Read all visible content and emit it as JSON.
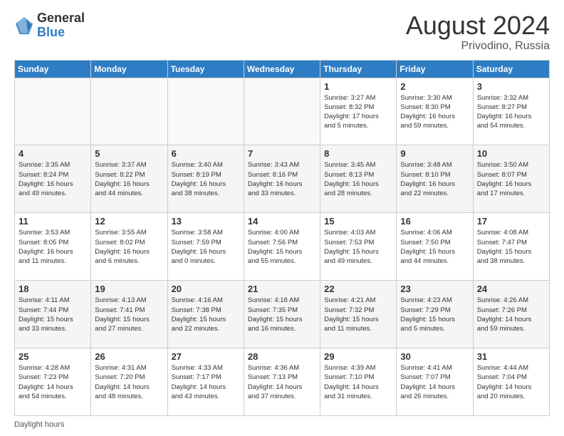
{
  "header": {
    "logo_general": "General",
    "logo_blue": "Blue",
    "month": "August 2024",
    "location": "Privodino, Russia"
  },
  "days_of_week": [
    "Sunday",
    "Monday",
    "Tuesday",
    "Wednesday",
    "Thursday",
    "Friday",
    "Saturday"
  ],
  "footer_label": "Daylight hours",
  "weeks": [
    [
      {
        "num": "",
        "info": ""
      },
      {
        "num": "",
        "info": ""
      },
      {
        "num": "",
        "info": ""
      },
      {
        "num": "",
        "info": ""
      },
      {
        "num": "1",
        "info": "Sunrise: 3:27 AM\nSunset: 8:32 PM\nDaylight: 17 hours\nand 5 minutes."
      },
      {
        "num": "2",
        "info": "Sunrise: 3:30 AM\nSunset: 8:30 PM\nDaylight: 16 hours\nand 59 minutes."
      },
      {
        "num": "3",
        "info": "Sunrise: 3:32 AM\nSunset: 8:27 PM\nDaylight: 16 hours\nand 54 minutes."
      }
    ],
    [
      {
        "num": "4",
        "info": "Sunrise: 3:35 AM\nSunset: 8:24 PM\nDaylight: 16 hours\nand 49 minutes."
      },
      {
        "num": "5",
        "info": "Sunrise: 3:37 AM\nSunset: 8:22 PM\nDaylight: 16 hours\nand 44 minutes."
      },
      {
        "num": "6",
        "info": "Sunrise: 3:40 AM\nSunset: 8:19 PM\nDaylight: 16 hours\nand 38 minutes."
      },
      {
        "num": "7",
        "info": "Sunrise: 3:43 AM\nSunset: 8:16 PM\nDaylight: 16 hours\nand 33 minutes."
      },
      {
        "num": "8",
        "info": "Sunrise: 3:45 AM\nSunset: 8:13 PM\nDaylight: 16 hours\nand 28 minutes."
      },
      {
        "num": "9",
        "info": "Sunrise: 3:48 AM\nSunset: 8:10 PM\nDaylight: 16 hours\nand 22 minutes."
      },
      {
        "num": "10",
        "info": "Sunrise: 3:50 AM\nSunset: 8:07 PM\nDaylight: 16 hours\nand 17 minutes."
      }
    ],
    [
      {
        "num": "11",
        "info": "Sunrise: 3:53 AM\nSunset: 8:05 PM\nDaylight: 16 hours\nand 11 minutes."
      },
      {
        "num": "12",
        "info": "Sunrise: 3:55 AM\nSunset: 8:02 PM\nDaylight: 16 hours\nand 6 minutes."
      },
      {
        "num": "13",
        "info": "Sunrise: 3:58 AM\nSunset: 7:59 PM\nDaylight: 16 hours\nand 0 minutes."
      },
      {
        "num": "14",
        "info": "Sunrise: 4:00 AM\nSunset: 7:56 PM\nDaylight: 15 hours\nand 55 minutes."
      },
      {
        "num": "15",
        "info": "Sunrise: 4:03 AM\nSunset: 7:53 PM\nDaylight: 15 hours\nand 49 minutes."
      },
      {
        "num": "16",
        "info": "Sunrise: 4:06 AM\nSunset: 7:50 PM\nDaylight: 15 hours\nand 44 minutes."
      },
      {
        "num": "17",
        "info": "Sunrise: 4:08 AM\nSunset: 7:47 PM\nDaylight: 15 hours\nand 38 minutes."
      }
    ],
    [
      {
        "num": "18",
        "info": "Sunrise: 4:11 AM\nSunset: 7:44 PM\nDaylight: 15 hours\nand 33 minutes."
      },
      {
        "num": "19",
        "info": "Sunrise: 4:13 AM\nSunset: 7:41 PM\nDaylight: 15 hours\nand 27 minutes."
      },
      {
        "num": "20",
        "info": "Sunrise: 4:16 AM\nSunset: 7:38 PM\nDaylight: 15 hours\nand 22 minutes."
      },
      {
        "num": "21",
        "info": "Sunrise: 4:18 AM\nSunset: 7:35 PM\nDaylight: 15 hours\nand 16 minutes."
      },
      {
        "num": "22",
        "info": "Sunrise: 4:21 AM\nSunset: 7:32 PM\nDaylight: 15 hours\nand 11 minutes."
      },
      {
        "num": "23",
        "info": "Sunrise: 4:23 AM\nSunset: 7:29 PM\nDaylight: 15 hours\nand 5 minutes."
      },
      {
        "num": "24",
        "info": "Sunrise: 4:26 AM\nSunset: 7:26 PM\nDaylight: 14 hours\nand 59 minutes."
      }
    ],
    [
      {
        "num": "25",
        "info": "Sunrise: 4:28 AM\nSunset: 7:23 PM\nDaylight: 14 hours\nand 54 minutes."
      },
      {
        "num": "26",
        "info": "Sunrise: 4:31 AM\nSunset: 7:20 PM\nDaylight: 14 hours\nand 48 minutes."
      },
      {
        "num": "27",
        "info": "Sunrise: 4:33 AM\nSunset: 7:17 PM\nDaylight: 14 hours\nand 43 minutes."
      },
      {
        "num": "28",
        "info": "Sunrise: 4:36 AM\nSunset: 7:13 PM\nDaylight: 14 hours\nand 37 minutes."
      },
      {
        "num": "29",
        "info": "Sunrise: 4:39 AM\nSunset: 7:10 PM\nDaylight: 14 hours\nand 31 minutes."
      },
      {
        "num": "30",
        "info": "Sunrise: 4:41 AM\nSunset: 7:07 PM\nDaylight: 14 hours\nand 26 minutes."
      },
      {
        "num": "31",
        "info": "Sunrise: 4:44 AM\nSunset: 7:04 PM\nDaylight: 14 hours\nand 20 minutes."
      }
    ]
  ]
}
